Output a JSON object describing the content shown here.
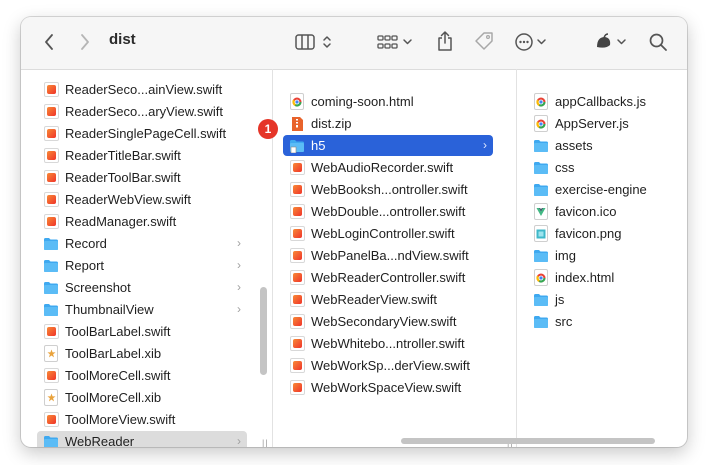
{
  "window": {
    "title": "dist"
  },
  "toolbar": {
    "back": "back-icon",
    "forward": "forward-icon",
    "view": "columns-view-icon",
    "group": "grid-group-icon",
    "share": "share-icon",
    "tag": "tag-icon",
    "more": "ellipsis-circle-icon",
    "app": "app-menu-icon",
    "search": "search-icon"
  },
  "column1": [
    {
      "label": "ReaderSeco...ainView.swift",
      "kind": "swift"
    },
    {
      "label": "ReaderSeco...aryView.swift",
      "kind": "swift"
    },
    {
      "label": "ReaderSinglePageCell.swift",
      "kind": "swift"
    },
    {
      "label": "ReaderTitleBar.swift",
      "kind": "swift"
    },
    {
      "label": "ReaderToolBar.swift",
      "kind": "swift"
    },
    {
      "label": "ReaderWebView.swift",
      "kind": "swift"
    },
    {
      "label": "ReadManager.swift",
      "kind": "swift"
    },
    {
      "label": "Record",
      "kind": "folder"
    },
    {
      "label": "Report",
      "kind": "folder"
    },
    {
      "label": "Screenshot",
      "kind": "folder"
    },
    {
      "label": "ThumbnailView",
      "kind": "folder"
    },
    {
      "label": "ToolBarLabel.swift",
      "kind": "swift"
    },
    {
      "label": "ToolBarLabel.xib",
      "kind": "xib"
    },
    {
      "label": "ToolMoreCell.swift",
      "kind": "swift"
    },
    {
      "label": "ToolMoreCell.xib",
      "kind": "xib"
    },
    {
      "label": "ToolMoreView.swift",
      "kind": "swift"
    },
    {
      "label": "WebReader",
      "kind": "folder",
      "selected": "inactive"
    }
  ],
  "column2": [
    {
      "label": "coming-soon.html",
      "kind": "html"
    },
    {
      "label": "dist.zip",
      "kind": "zip"
    },
    {
      "label": "h5",
      "kind": "folder-file",
      "selected": "active"
    },
    {
      "label": "WebAudioRecorder.swift",
      "kind": "swift"
    },
    {
      "label": "WebBooksh...ontroller.swift",
      "kind": "swift"
    },
    {
      "label": "WebDouble...ontroller.swift",
      "kind": "swift"
    },
    {
      "label": "WebLoginController.swift",
      "kind": "swift"
    },
    {
      "label": "WebPanelBa...ndView.swift",
      "kind": "swift"
    },
    {
      "label": "WebReaderController.swift",
      "kind": "swift"
    },
    {
      "label": "WebReaderView.swift",
      "kind": "swift"
    },
    {
      "label": "WebSecondaryView.swift",
      "kind": "swift"
    },
    {
      "label": "WebWhitebo...ntroller.swift",
      "kind": "swift"
    },
    {
      "label": "WebWorkSp...derView.swift",
      "kind": "swift"
    },
    {
      "label": "WebWorkSpaceView.swift",
      "kind": "swift"
    }
  ],
  "column3": [
    {
      "label": "appCallbacks.js",
      "kind": "html"
    },
    {
      "label": "AppServer.js",
      "kind": "html"
    },
    {
      "label": "assets",
      "kind": "folder"
    },
    {
      "label": "css",
      "kind": "folder"
    },
    {
      "label": "exercise-engine",
      "kind": "folder"
    },
    {
      "label": "favicon.ico",
      "kind": "ico"
    },
    {
      "label": "favicon.png",
      "kind": "png"
    },
    {
      "label": "img",
      "kind": "folder"
    },
    {
      "label": "index.html",
      "kind": "html"
    },
    {
      "label": "js",
      "kind": "folder"
    },
    {
      "label": "src",
      "kind": "folder"
    }
  ],
  "annotation": {
    "badge": "1"
  },
  "colors": {
    "accent": "#2a62d9",
    "folder": "#3fa9f0",
    "badge": "#e53528"
  }
}
